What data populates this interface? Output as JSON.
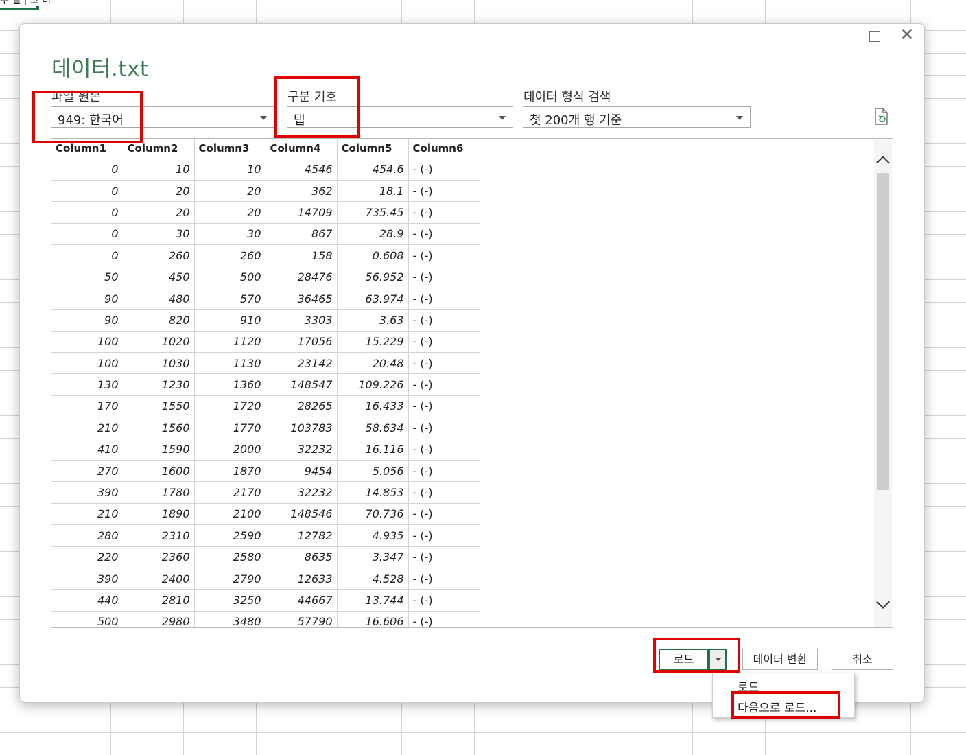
{
  "background": {
    "cell_text": "무 얼 | 코 더"
  },
  "dialog": {
    "title": "데이터.txt",
    "file_origin": {
      "label": "파일 원본",
      "value": "949: 한국어"
    },
    "delimiter": {
      "label": "구분 기호",
      "value": "탭"
    },
    "type_detection": {
      "label": "데이터 형식 검색",
      "value": "첫 200개 행 기준"
    },
    "columns": [
      "Column1",
      "Column2",
      "Column3",
      "Column4",
      "Column5",
      "Column6"
    ],
    "rows": [
      [
        "0",
        "10",
        "10",
        "4546",
        "454.6",
        "- (-)"
      ],
      [
        "0",
        "20",
        "20",
        "362",
        "18.1",
        "- (-)"
      ],
      [
        "0",
        "20",
        "20",
        "14709",
        "735.45",
        "- (-)"
      ],
      [
        "0",
        "30",
        "30",
        "867",
        "28.9",
        "- (-)"
      ],
      [
        "0",
        "260",
        "260",
        "158",
        "0.608",
        "- (-)"
      ],
      [
        "50",
        "450",
        "500",
        "28476",
        "56.952",
        "- (-)"
      ],
      [
        "90",
        "480",
        "570",
        "36465",
        "63.974",
        "- (-)"
      ],
      [
        "90",
        "820",
        "910",
        "3303",
        "3.63",
        "- (-)"
      ],
      [
        "100",
        "1020",
        "1120",
        "17056",
        "15.229",
        "- (-)"
      ],
      [
        "100",
        "1030",
        "1130",
        "23142",
        "20.48",
        "- (-)"
      ],
      [
        "130",
        "1230",
        "1360",
        "148547",
        "109.226",
        "- (-)"
      ],
      [
        "170",
        "1550",
        "1720",
        "28265",
        "16.433",
        "- (-)"
      ],
      [
        "210",
        "1560",
        "1770",
        "103783",
        "58.634",
        "- (-)"
      ],
      [
        "410",
        "1590",
        "2000",
        "32232",
        "16.116",
        "- (-)"
      ],
      [
        "270",
        "1600",
        "1870",
        "9454",
        "5.056",
        "- (-)"
      ],
      [
        "390",
        "1780",
        "2170",
        "32232",
        "14.853",
        "- (-)"
      ],
      [
        "210",
        "1890",
        "2100",
        "148546",
        "70.736",
        "- (-)"
      ],
      [
        "280",
        "2310",
        "2590",
        "12782",
        "4.935",
        "- (-)"
      ],
      [
        "220",
        "2360",
        "2580",
        "8635",
        "3.347",
        "- (-)"
      ],
      [
        "390",
        "2400",
        "2790",
        "12633",
        "4.528",
        "- (-)"
      ],
      [
        "440",
        "2810",
        "3250",
        "44667",
        "13.744",
        "- (-)"
      ],
      [
        "500",
        "2980",
        "3480",
        "57790",
        "16.606",
        "- (-)"
      ]
    ],
    "buttons": {
      "load": "로드",
      "transform": "데이터 변환",
      "cancel": "취소"
    },
    "load_menu": {
      "items": [
        "로드",
        "다음으로 로드..."
      ]
    }
  },
  "colors": {
    "title_green": "#3c7b55",
    "accent_green": "#217346",
    "highlight_red": "#e00000"
  }
}
